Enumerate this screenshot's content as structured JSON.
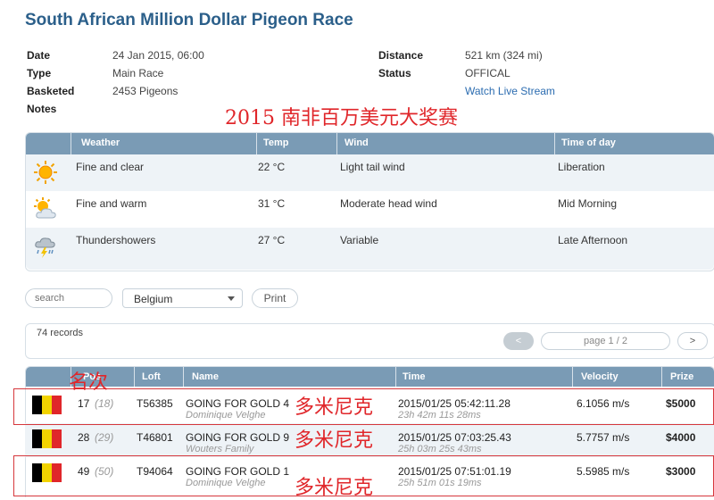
{
  "race": {
    "title": "South African Million Dollar Pigeon Race",
    "date_label": "Date",
    "date": "24 Jan 2015, 06:00",
    "type_label": "Type",
    "type": "Main Race",
    "basketed_label": "Basketed",
    "basketed": "2453 Pigeons",
    "notes_label": "Notes",
    "distance_label": "Distance",
    "distance": "521 km (324 mi)",
    "status_label": "Status",
    "status": "OFFICAL",
    "live_stream": "Watch Live Stream"
  },
  "annotation": {
    "banner": "2015 南非百万美元大奖赛",
    "rank_label": "名次",
    "country_label": "多米尼克"
  },
  "weather": {
    "headers": [
      "Weather",
      "Temp",
      "Wind",
      "Time of day"
    ],
    "rows": [
      {
        "icon": "sun-icon",
        "desc": "Fine and clear",
        "temp": "22 °C",
        "wind": "Light tail wind",
        "time": "Liberation"
      },
      {
        "icon": "sun-cloud-icon",
        "desc": "Fine and warm",
        "temp": "31 °C",
        "wind": "Moderate head wind",
        "time": "Mid Morning"
      },
      {
        "icon": "thunderstorm-icon",
        "desc": "Thundershowers",
        "temp": "27 °C",
        "wind": "Variable",
        "time": "Late Afternoon"
      }
    ]
  },
  "controls": {
    "search_placeholder": "search",
    "country_selected": "Belgium",
    "print_label": "Print"
  },
  "records": {
    "count": "74 records",
    "prev": "<",
    "next": ">",
    "page": "page 1 / 2"
  },
  "results": {
    "headers": [
      "Pos",
      "Loft",
      "Name",
      "Time",
      "Velocity",
      "Prize"
    ],
    "flag_colors": [
      "#000000",
      "#f2d300",
      "#e0262a"
    ],
    "rows": [
      {
        "pos": "17",
        "rank": "(18)",
        "loft": "T56385",
        "name": "GOING FOR GOLD 4",
        "owner": "Dominique Velghe",
        "time": "2015/01/25 05:42:11.28",
        "elapsed": "23h 42m 11s 28ms",
        "velocity": "6.1056 m/s",
        "prize": "$5000"
      },
      {
        "pos": "28",
        "rank": "(29)",
        "loft": "T46801",
        "name": "GOING FOR GOLD 9",
        "owner": "Wouters Family",
        "time": "2015/01/25 07:03:25.43",
        "elapsed": "25h 03m 25s 43ms",
        "velocity": "5.7757 m/s",
        "prize": "$4000"
      },
      {
        "pos": "49",
        "rank": "(50)",
        "loft": "T94064",
        "name": "GOING FOR GOLD 1",
        "owner": "Dominique Velghe",
        "time": "2015/01/25 07:51:01.19",
        "elapsed": "25h 51m 01s 19ms",
        "velocity": "5.5985 m/s",
        "prize": "$3000"
      }
    ]
  }
}
